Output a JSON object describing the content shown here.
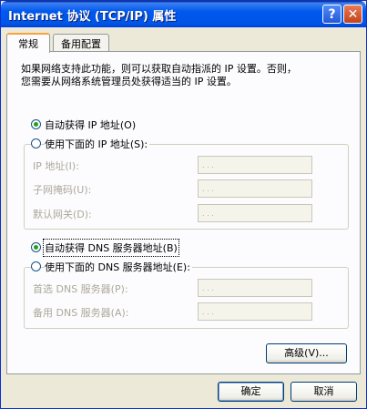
{
  "window": {
    "title": "Internet 协议 (TCP/IP) 属性",
    "help_label": "?",
    "close_label": "✕"
  },
  "tabs": [
    {
      "label": "常规",
      "active": true
    },
    {
      "label": "备用配置",
      "active": false
    }
  ],
  "general": {
    "description_line1": "如果网络支持此功能，则可以获取自动指派的 IP 设置。否则，",
    "description_line2": "您需要从网络系统管理员处获得适当的 IP 设置。",
    "ip": {
      "auto_label": "自动获得 IP 地址(O)",
      "manual_label": "使用下面的 IP 地址(S):",
      "selected": "auto",
      "fields": [
        {
          "label": "IP 地址(I):",
          "value": " .  .  . "
        },
        {
          "label": "子网掩码(U):",
          "value": " .  .  . "
        },
        {
          "label": "默认网关(D):",
          "value": " .  .  . "
        }
      ]
    },
    "dns": {
      "auto_label": "自动获得 DNS 服务器地址(B)",
      "manual_label": "使用下面的 DNS 服务器地址(E):",
      "selected": "auto",
      "fields": [
        {
          "label": "首选 DNS 服务器(P):",
          "value": " .  .  . "
        },
        {
          "label": "备用 DNS 服务器(A):",
          "value": " .  .  . "
        }
      ]
    },
    "advanced_label": "高级(V)..."
  },
  "footer": {
    "ok_label": "确定",
    "cancel_label": "取消"
  },
  "colors": {
    "titlebar": "#0055E5",
    "dialog_bg": "#ECE9D8",
    "tab_highlight": "#F8A23A",
    "radio_dot": "#21A121"
  }
}
